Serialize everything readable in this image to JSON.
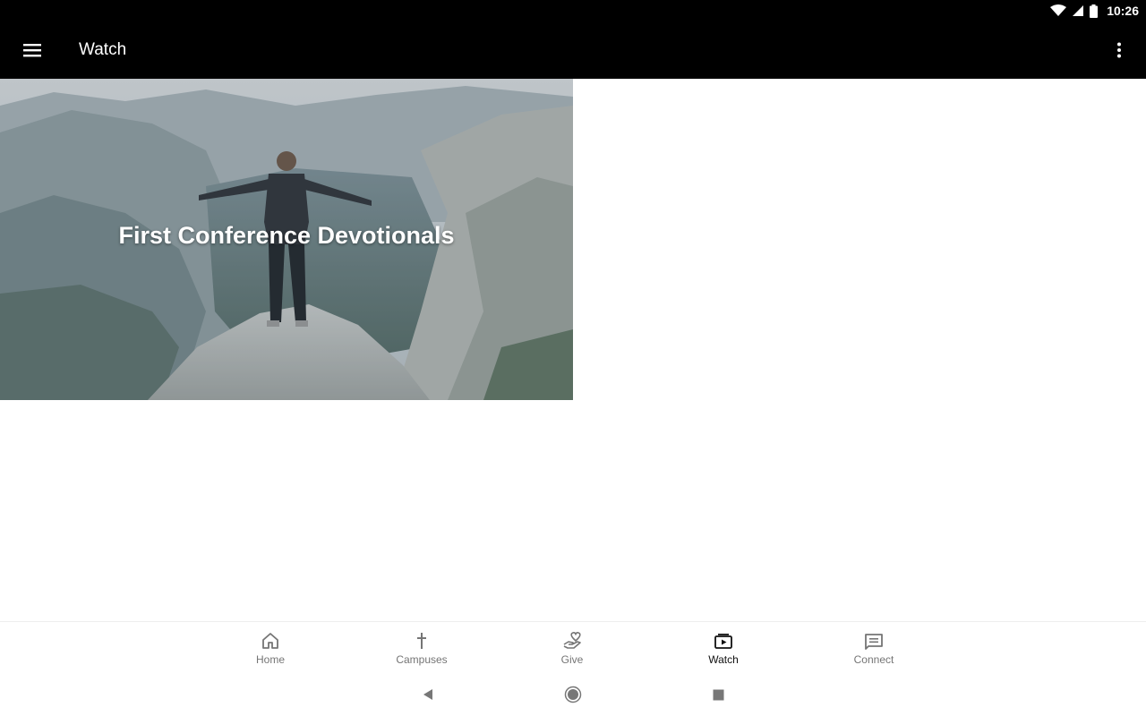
{
  "status_bar": {
    "time": "10:26"
  },
  "app_bar": {
    "title": "Watch"
  },
  "content": {
    "cards": [
      {
        "title": "First Conference Devotionals"
      }
    ]
  },
  "bottom_nav": {
    "items": [
      {
        "label": "Home",
        "icon": "home-icon"
      },
      {
        "label": "Campuses",
        "icon": "cross-icon"
      },
      {
        "label": "Give",
        "icon": "give-hand-heart-icon"
      },
      {
        "label": "Watch",
        "icon": "video-play-icon",
        "active": true
      },
      {
        "label": "Connect",
        "icon": "message-icon"
      }
    ]
  },
  "colors": {
    "bar": "#000000",
    "active": "#111111",
    "inactive": "#757575"
  }
}
